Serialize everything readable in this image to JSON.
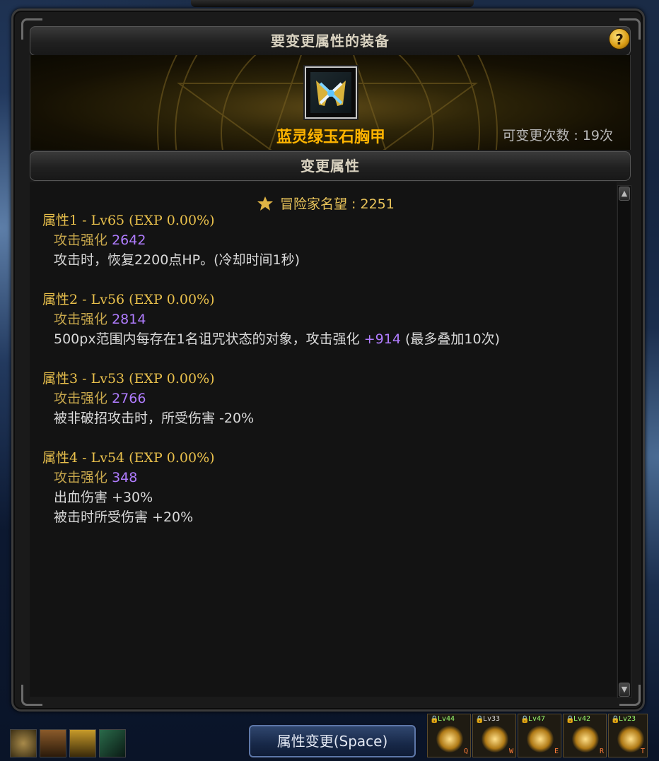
{
  "window": {
    "equip_header": "要变更属性的装备",
    "help_label": "?",
    "item_name": "蓝灵绿玉石胸甲",
    "change_count": "可变更次数 : 19次",
    "change_header": "变更属性"
  },
  "fame": {
    "label": "冒险家名望 : 2251",
    "icon": "fame-star-icon"
  },
  "attributes": [
    {
      "title": "属性1 - Lv65 (EXP 0.00%)",
      "stat_label": "攻击强化",
      "stat_value": "2642",
      "effects": [
        "攻击时，恢复2200点HP。(冷却时间1秒)"
      ]
    },
    {
      "title": "属性2 - Lv56 (EXP 0.00%)",
      "stat_label": "攻击强化",
      "stat_value": "2814",
      "effect_prefix": "500px范围内每存在1名诅咒状态的对象，攻击强化",
      "effect_value": "+914",
      "effect_suffix": "(最多叠加10次)"
    },
    {
      "title": "属性3 - Lv53 (EXP 0.00%)",
      "stat_label": "攻击强化",
      "stat_value": "2766",
      "effects": [
        "被非破招攻击时，所受伤害 -20%"
      ]
    },
    {
      "title": "属性4 - Lv54 (EXP 0.00%)",
      "stat_label": "攻击强化",
      "stat_value": "348",
      "effects": [
        "出血伤害 +30%",
        "被击时所受伤害 +20%"
      ]
    }
  ],
  "scroll": {
    "up": "▲",
    "down": "▼"
  },
  "change_button": "属性变更(Space)",
  "skills": [
    {
      "lv": "Lv44",
      "key": "Q"
    },
    {
      "lv": "Lv33",
      "key": "W"
    },
    {
      "lv": "Lv47",
      "key": "E"
    },
    {
      "lv": "Lv42",
      "key": "R"
    },
    {
      "lv": "Lv23",
      "key": "T"
    }
  ],
  "colors": {
    "gold": "#e9c04c",
    "item_name": "#ffb400",
    "purple": "#b07cff"
  }
}
